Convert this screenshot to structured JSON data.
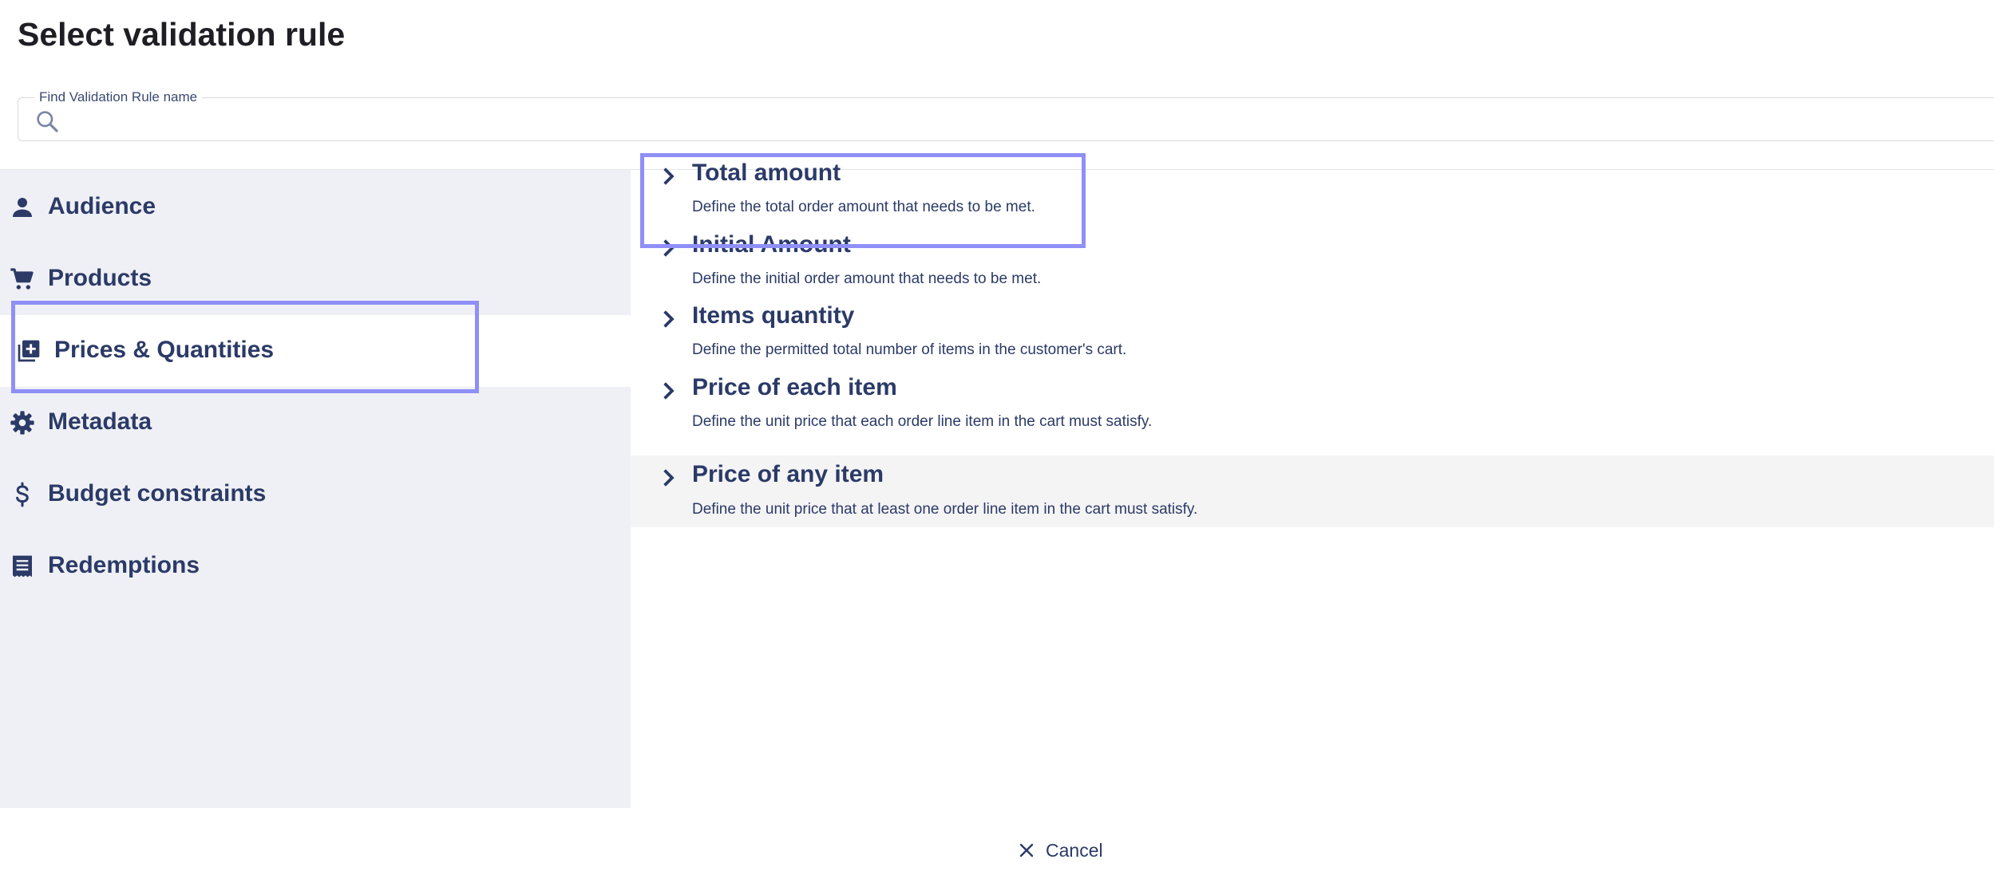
{
  "dialog": {
    "title": "Select validation rule",
    "search": {
      "label": "Find Validation Rule name",
      "placeholder": "",
      "value": ""
    }
  },
  "categories": [
    {
      "label": "Audience",
      "icon": "person-icon",
      "selected": false
    },
    {
      "label": "Products",
      "icon": "cart-icon",
      "selected": false
    },
    {
      "label": "Prices & Quantities",
      "icon": "add-box-icon",
      "selected": true
    },
    {
      "label": "Metadata",
      "icon": "gear-icon",
      "selected": false
    },
    {
      "label": "Budget constraints",
      "icon": "dollar-icon",
      "selected": false
    },
    {
      "label": "Redemptions",
      "icon": "receipt-icon",
      "selected": false
    }
  ],
  "rules": [
    {
      "title": "Total amount",
      "description": "Define the total order amount that needs to be met."
    },
    {
      "title": "Initial Amount",
      "description": "Define the initial order amount that needs to be met."
    },
    {
      "title": "Items quantity",
      "description": "Define the permitted total number of items in the customer's cart."
    },
    {
      "title": "Price of each item",
      "description": "Define the unit price that each order line item in the cart must satisfy."
    },
    {
      "title": "Price of any item",
      "description": "Define the unit price that at least one order line item in the cart must satisfy."
    }
  ],
  "footer": {
    "cancel_label": "Cancel"
  },
  "colors": {
    "text": "#2b3a67",
    "sidebar_bg": "#eff0f5",
    "highlight": "#8f8ff7",
    "hover_row": "#f4f4f5"
  }
}
